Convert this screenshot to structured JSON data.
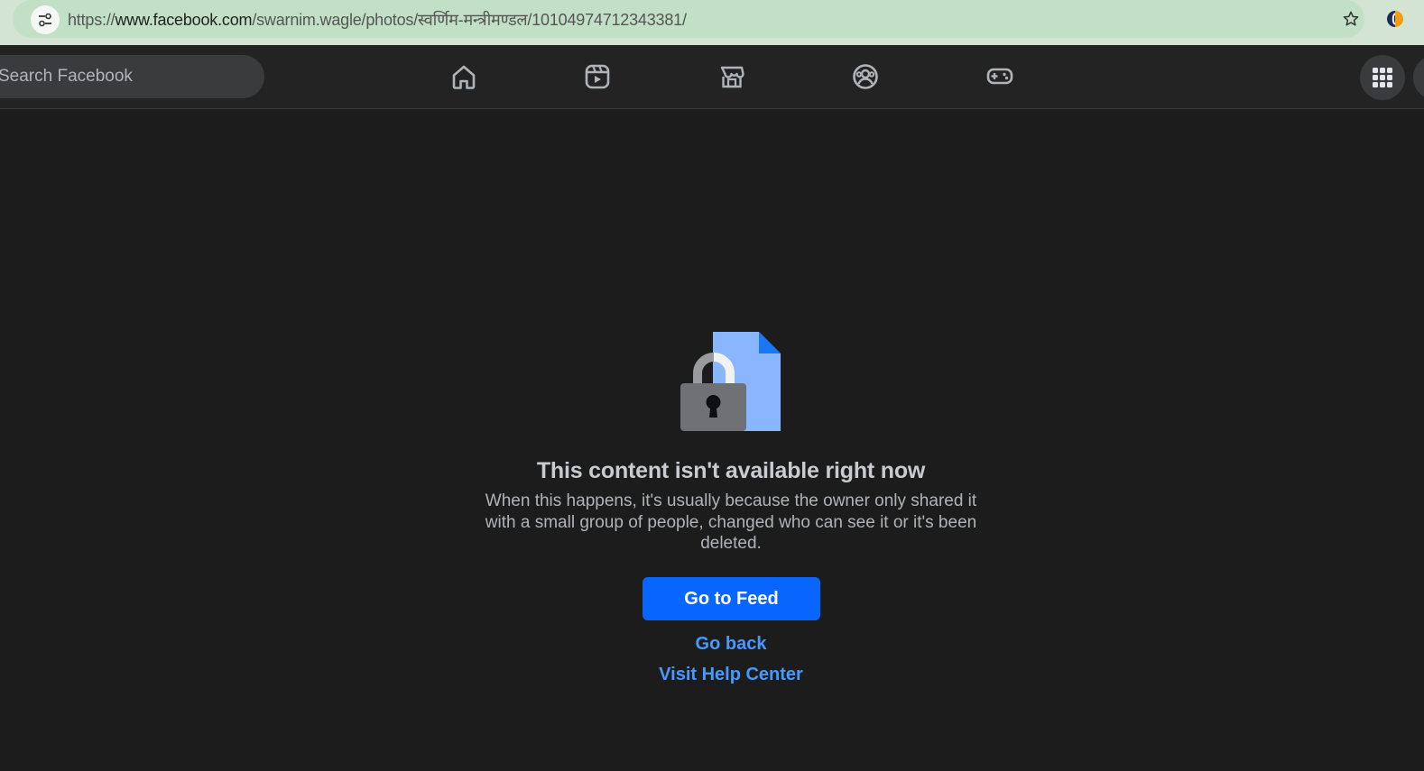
{
  "browser": {
    "url_prefix": "https://",
    "url_host": "www.facebook.com",
    "url_path": "/swarnim.wagle/photos/स्वर्णिम-मन्त्रीमण्डल/10104974712343381/"
  },
  "topbar": {
    "search_placeholder": "Search Facebook",
    "nav_icons": [
      "home-icon",
      "video-icon",
      "marketplace-icon",
      "groups-icon",
      "gaming-icon"
    ],
    "menu_icon": "grid-menu-icon"
  },
  "content": {
    "title": "This content isn't available right now",
    "description": "When this happens, it's usually because the owner only shared it with a small group of people, changed who can see it or it's been deleted.",
    "primary_button": "Go to Feed",
    "link_back": "Go back",
    "link_help": "Visit Help Center"
  },
  "colors": {
    "primary": "#0866ff",
    "link": "#4599ff",
    "background": "#1c1c1d",
    "omnibox": "#c2e0c6"
  }
}
